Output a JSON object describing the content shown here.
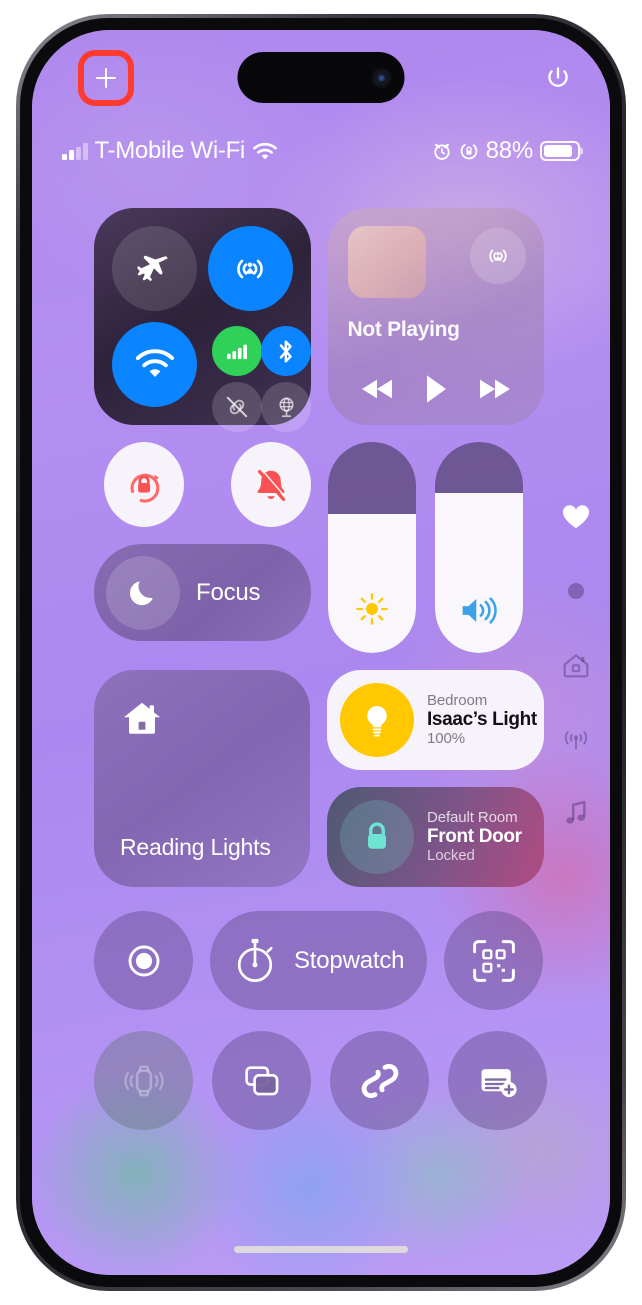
{
  "device": {
    "name": "iphone-control-center",
    "accent_red": "#ff3b30",
    "accent_blue": "#0a84ff",
    "accent_green": "#30d158",
    "accent_yellow": "#ffc800"
  },
  "top_bar": {
    "add_button": {
      "name": "add-control-button",
      "label": "+",
      "highlight_color": "#ff3b30"
    },
    "power_button": {
      "name": "power-button",
      "label": "Power"
    }
  },
  "status_bar": {
    "carrier": "T-Mobile Wi-Fi",
    "signal_bars_filled": 2,
    "signal_bars_total": 4,
    "wifi_icon": "wifi-icon",
    "alarm_icon": "alarm-clock-icon",
    "rotation_lock_icon": "rotation-lock-icon",
    "battery_percent": "88%",
    "battery_fill_ratio": 0.88
  },
  "connectivity": {
    "airplane_mode": {
      "label": "Airplane Mode",
      "icon": "airplane-icon",
      "state": "off"
    },
    "airdrop": {
      "label": "AirDrop",
      "icon": "airdrop-icon",
      "state": "on"
    },
    "wifi": {
      "label": "Wi-Fi",
      "icon": "wifi-icon",
      "state": "on"
    },
    "cellular": {
      "label": "Cellular Data",
      "icon": "cellular-bars-icon",
      "state": "on"
    },
    "bluetooth": {
      "label": "Bluetooth",
      "icon": "bluetooth-icon",
      "state": "on"
    },
    "hotspot": {
      "label": "Personal Hotspot",
      "icon": "hotspot-off-icon",
      "state": "off"
    },
    "vpn": {
      "label": "VPN",
      "icon": "vpn-globe-icon",
      "state": "off"
    }
  },
  "media": {
    "title": "Not Playing",
    "artwork": "album-artwork-placeholder",
    "airplay_icon": "airplay-icon",
    "rewind_label": "Rewind",
    "play_label": "Play",
    "forward_label": "Fast Forward"
  },
  "toggles": {
    "rotation_lock": {
      "label": "Rotation Lock",
      "icon": "rotation-lock-icon",
      "state": "on"
    },
    "silent_mode": {
      "label": "Silent Mode",
      "icon": "bell-slash-icon",
      "state": "on"
    },
    "focus": {
      "label": "Focus",
      "icon": "moon-icon",
      "state": "off"
    }
  },
  "sliders": {
    "brightness": {
      "label": "Brightness",
      "icon": "sun-icon",
      "value": 66
    },
    "volume": {
      "label": "Volume",
      "icon": "speaker-wave-icon",
      "value": 76
    }
  },
  "home": {
    "scene": {
      "label": "Reading Lights",
      "icon": "house-icon"
    },
    "accessories": [
      {
        "room": "Bedroom",
        "name": "Isaac’s Light",
        "state": "100%",
        "icon": "lightbulb-icon",
        "active": true
      },
      {
        "room": "Default Room",
        "name": "Front Door",
        "state": "Locked",
        "icon": "lock-icon",
        "active": false
      }
    ]
  },
  "utilities": {
    "row1": [
      {
        "label": "Screen Recording",
        "icon": "screen-record-icon",
        "shape": "circle",
        "dim": false
      },
      {
        "label": "Stopwatch",
        "icon": "stopwatch-icon",
        "shape": "pill",
        "dim": false
      },
      {
        "label": "Scan Code",
        "icon": "qr-code-icon",
        "shape": "circle",
        "dim": false
      }
    ],
    "row2": [
      {
        "label": "Ping My Watch",
        "icon": "ping-watch-icon",
        "shape": "circle",
        "dim": true
      },
      {
        "label": "App Mirroring",
        "icon": "app-mirroring-icon",
        "shape": "circle",
        "dim": false
      },
      {
        "label": "Music Recognition",
        "icon": "shazam-icon",
        "shape": "circle",
        "dim": false
      },
      {
        "label": "Quick Note",
        "icon": "quick-note-icon",
        "shape": "circle",
        "dim": false
      }
    ]
  },
  "page_rail": [
    {
      "label": "Favorites",
      "icon": "heart-icon",
      "active": true
    },
    {
      "label": "Page Indicator",
      "icon": "page-dot-icon",
      "active": false
    },
    {
      "label": "Home",
      "icon": "home-outline-icon",
      "active": false
    },
    {
      "label": "Connectivity",
      "icon": "connectivity-antenna-icon",
      "active": false
    },
    {
      "label": "Now Playing",
      "icon": "music-note-icon",
      "active": false
    }
  ],
  "home_indicator": {
    "label": "Home Indicator"
  }
}
